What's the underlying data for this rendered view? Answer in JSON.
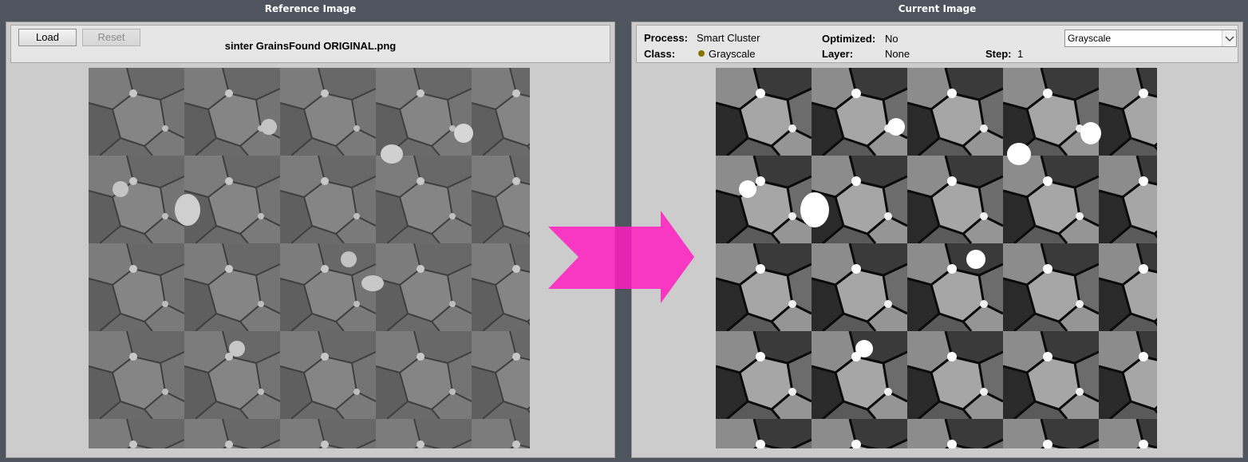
{
  "reference_pane": {
    "title": "Reference Image",
    "load_label": "Load",
    "reset_label": "Reset",
    "filename": "sinter GrainsFound ORIGINAL.png"
  },
  "current_pane": {
    "title": "Current Image",
    "process_label": "Process:",
    "process_value": "Smart Cluster",
    "class_label": "Class:",
    "class_value": "Grayscale",
    "optimized_label": "Optimized:",
    "optimized_value": "No",
    "layer_label": "Layer:",
    "layer_value": "None",
    "step_label": "Step:",
    "step_value": "1",
    "view_select": {
      "selected": "Grayscale"
    }
  },
  "colors": {
    "background": "#4f555e",
    "panel": "#cccccc",
    "arrow": "#ff1cc0",
    "class_dot": "#8a7400"
  },
  "icons": [
    "chevron-down-icon",
    "right-arrow-icon"
  ]
}
